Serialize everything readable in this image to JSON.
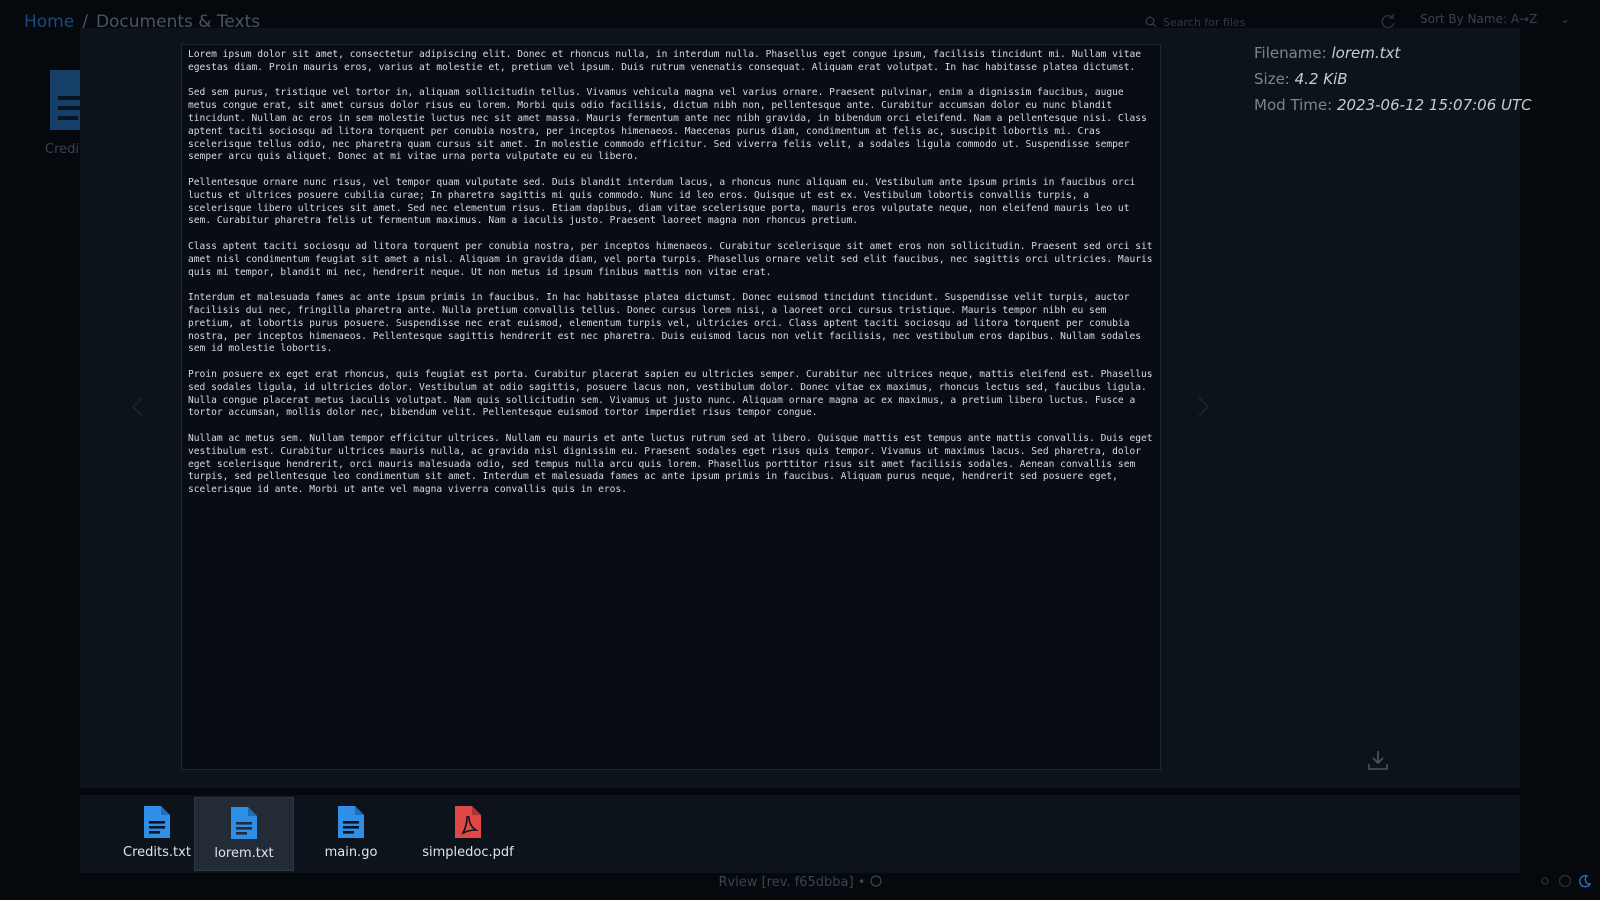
{
  "breadcrumb": {
    "home": "Home",
    "separator": "/",
    "current": "Documents & Texts"
  },
  "search": {
    "placeholder": "Search for files"
  },
  "sort": {
    "label": "Sort By Name: A→Z"
  },
  "background_file": {
    "label": "Credit"
  },
  "viewer": {
    "paragraphs": [
      "Lorem ipsum dolor sit amet, consectetur adipiscing elit. Donec et rhoncus nulla, in interdum nulla. Phasellus eget congue ipsum, facilisis tincidunt mi. Nullam vitae egestas diam. Proin mauris eros, varius at molestie et, pretium vel ipsum. Duis rutrum venenatis consequat. Aliquam erat volutpat. In hac habitasse platea dictumst.",
      "Sed sem purus, tristique vel tortor in, aliquam sollicitudin tellus. Vivamus vehicula magna vel varius ornare. Praesent pulvinar, enim a dignissim faucibus, augue metus congue erat, sit amet cursus dolor risus eu lorem. Morbi quis odio facilisis, dictum nibh non, pellentesque ante. Curabitur accumsan dolor eu nunc blandit tincidunt. Nullam ac eros in sem molestie luctus nec sit amet massa. Mauris fermentum ante nec nibh gravida, in bibendum orci eleifend. Nam a pellentesque nisi. Class aptent taciti sociosqu ad litora torquent per conubia nostra, per inceptos himenaeos. Maecenas purus diam, condimentum at felis ac, suscipit lobortis mi. Cras scelerisque tellus odio, nec pharetra quam cursus sit amet. In molestie commodo efficitur. Sed viverra felis velit, a sodales ligula commodo ut. Suspendisse semper semper arcu quis aliquet. Donec at mi vitae urna porta vulputate eu eu libero.",
      "Pellentesque ornare nunc risus, vel tempor quam vulputate sed. Duis blandit interdum lacus, a rhoncus nunc aliquam eu. Vestibulum ante ipsum primis in faucibus orci luctus et ultrices posuere cubilia curae; In pharetra sagittis mi quis commodo. Nunc id leo eros. Quisque ut est ex. Vestibulum lobortis convallis turpis, a scelerisque libero ultrices sit amet. Sed nec elementum risus. Etiam dapibus, diam vitae scelerisque porta, mauris eros vulputate neque, non eleifend mauris leo ut sem. Curabitur pharetra felis ut fermentum maximus. Nam a iaculis justo. Praesent laoreet magna non rhoncus pretium.",
      "Class aptent taciti sociosqu ad litora torquent per conubia nostra, per inceptos himenaeos. Curabitur scelerisque sit amet eros non sollicitudin. Praesent sed orci sit amet nisl condimentum feugiat sit amet a nisl. Aliquam in gravida diam, vel porta turpis. Phasellus ornare velit sed elit faucibus, nec sagittis orci ultricies. Mauris quis mi tempor, blandit mi nec, hendrerit neque. Ut non metus id ipsum finibus mattis non vitae erat.",
      "Interdum et malesuada fames ac ante ipsum primis in faucibus. In hac habitasse platea dictumst. Donec euismod tincidunt tincidunt. Suspendisse velit turpis, auctor facilisis dui nec, fringilla pharetra ante. Nulla pretium convallis tellus. Donec cursus lorem nisi, a laoreet orci cursus tristique. Mauris tempor nibh eu sem pretium, at lobortis purus posuere. Suspendisse nec erat euismod, elementum turpis vel, ultricies orci. Class aptent taciti sociosqu ad litora torquent per conubia nostra, per inceptos himenaeos. Pellentesque sagittis hendrerit est nec pharetra. Duis euismod lacus non velit facilisis, nec vestibulum eros dapibus. Nullam sodales sem id molestie lobortis.",
      "Proin posuere ex eget erat rhoncus, quis feugiat est porta. Curabitur placerat sapien eu ultricies semper. Curabitur nec ultrices neque, mattis eleifend est. Phasellus sed sodales ligula, id ultricies dolor. Vestibulum at odio sagittis, posuere lacus non, vestibulum dolor. Donec vitae ex maximus, rhoncus lectus sed, faucibus ligula. Nulla congue placerat metus iaculis volutpat. Nam quis sollicitudin sem. Vivamus ut justo nunc. Aliquam ornare magna ac ex maximus, a pretium libero luctus. Fusce a tortor accumsan, mollis dolor nec, bibendum velit. Pellentesque euismod tortor imperdiet risus tempor congue.",
      "Nullam ac metus sem. Nullam tempor efficitur ultrices. Nullam eu mauris et ante luctus rutrum sed at libero. Quisque mattis est tempus ante mattis convallis. Duis eget vestibulum est. Curabitur ultrices mauris nulla, ac gravida nisl dignissim eu. Praesent sodales eget risus quis tempor. Vivamus ut maximus lacus. Sed pharetra, dolor eget scelerisque hendrerit, orci mauris malesuada odio, sed tempus nulla arcu quis lorem. Phasellus porttitor risus sit amet facilisis sodales. Aenean convallis sem turpis, sed pellentesque leo condimentum sit amet. Interdum et malesuada fames ac ante ipsum primis in faucibus. Aliquam purus neque, hendrerit sed posuere eget, scelerisque id ante. Morbi ut ante vel magna viverra convallis quis in eros."
    ]
  },
  "metadata": {
    "filename_label": "Filename:",
    "filename": "lorem.txt",
    "size_label": "Size:",
    "size": "4.2 KiB",
    "modtime_label": "Mod Time:",
    "modtime": "2023-06-12 15:07:06 UTC"
  },
  "thumbnails": [
    {
      "name": "Credits.txt",
      "icon": "text-file-icon",
      "color": "#2f8fe6"
    },
    {
      "name": "lorem.txt",
      "icon": "text-file-icon",
      "color": "#2f8fe6",
      "active": true
    },
    {
      "name": "main.go",
      "icon": "text-file-icon",
      "color": "#2f8fe6"
    },
    {
      "name": "simpledoc.pdf",
      "icon": "pdf-file-icon",
      "color": "#e04848"
    }
  ],
  "footer": {
    "text": "Rview [rev. f65dbba] •"
  },
  "colors": {
    "text_file": "#2f8fe6",
    "pdf_file": "#e04848",
    "background": "#05080c",
    "modal": "#0d131b"
  }
}
